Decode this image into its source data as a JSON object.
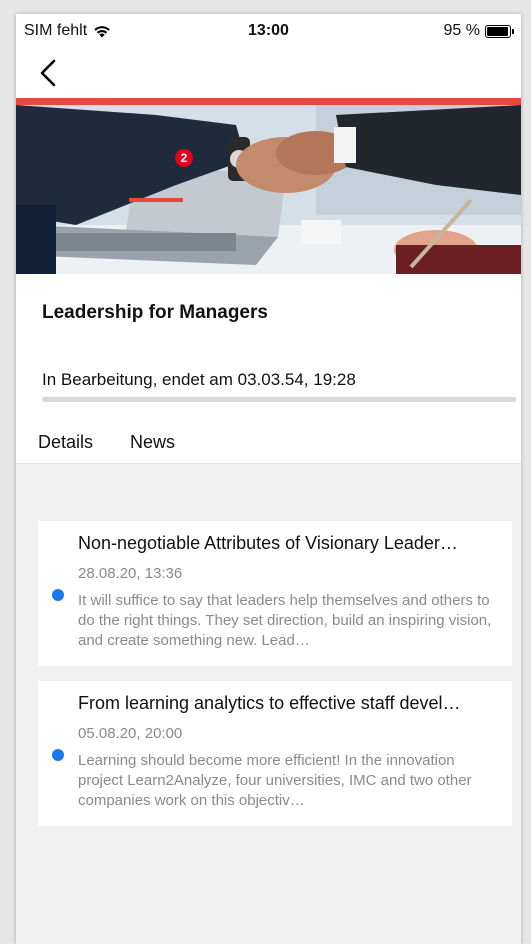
{
  "status_bar": {
    "carrier": "SIM fehlt",
    "time": "13:00",
    "battery_percent": "95 %",
    "battery_level": 0.95,
    "icons": [
      "wifi-icon",
      "battery-icon"
    ]
  },
  "nav": {
    "back_icon": "chevron-left-icon"
  },
  "colors": {
    "accent": "#e8473c",
    "badge": "#e3001b",
    "unread_dot": "#1778f2"
  },
  "course": {
    "title": "Leadership for Managers",
    "status": "In Bearbeitung, endet am 03.03.54, 19:28",
    "progress": 0
  },
  "tabs": [
    {
      "label": "Details",
      "active": false
    },
    {
      "label": "News",
      "active": true,
      "badge": "2"
    }
  ],
  "news": [
    {
      "title": "Non-negotiable Attributes of Visionary Leader…",
      "date": "28.08.20, 13:36",
      "excerpt": "It will suffice to say that leaders help themselves and others to do the right things. They set direction, build an inspiring vision, and create something new. Lead…",
      "unread": true
    },
    {
      "title": "From learning analytics to effective staff devel…",
      "date": "05.08.20, 20:00",
      "excerpt": "Learning should become more efficient! In the innovation project Learn2Analyze, four universities, IMC and two other companies work on this objectiv…",
      "unread": true
    }
  ]
}
